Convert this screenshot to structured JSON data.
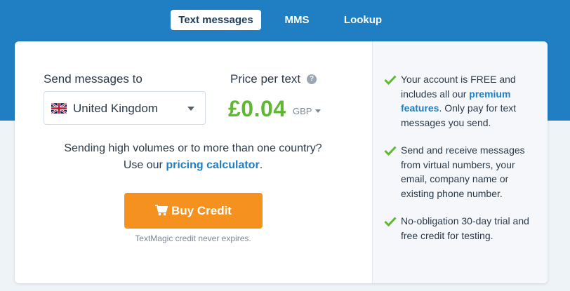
{
  "tabs": [
    {
      "label": "Text messages",
      "active": true
    },
    {
      "label": "MMS",
      "active": false
    },
    {
      "label": "Lookup",
      "active": false
    }
  ],
  "form": {
    "send_label": "Send messages to",
    "country_value": "United Kingdom",
    "country_flag_icon": "uk-flag-icon",
    "price_label": "Price per text",
    "price_value": "£0.04",
    "currency": "GBP"
  },
  "info": {
    "line1": "Sending high volumes or to more than one country?",
    "line2_prefix": "Use our ",
    "line2_link": "pricing calculator",
    "line2_suffix": "."
  },
  "buy": {
    "label": "Buy Credit",
    "icon": "cart-icon",
    "note": "TextMagic credit never expires."
  },
  "features": {
    "f1_text_a": "Your account is FREE and includes all our ",
    "f1_link": "premium features",
    "f1_text_b": ". Only pay for text messages you send.",
    "f2_text": "Send and receive messages from virtual numbers, your email, company name or existing phone number.",
    "f3_text": "No-obligation 30-day trial and free credit for testing."
  },
  "colors": {
    "brand_blue": "#1f7fc2",
    "price_green": "#5fb832",
    "button_orange": "#f5921f",
    "check_green": "#5fb832"
  }
}
